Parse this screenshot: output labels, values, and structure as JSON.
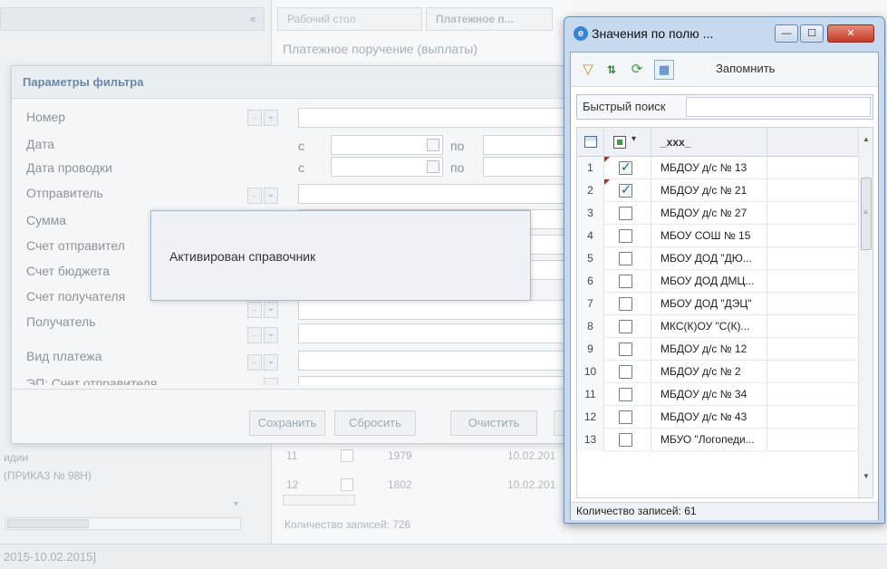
{
  "background": {
    "left_items": [
      "идии",
      "(ПРИКАЗ № 98Н)"
    ],
    "tabs": [
      "Рабочий стол",
      "Платежное п..."
    ],
    "doc_title": "Платежное поручение (выплаты)",
    "grid_rows": [
      {
        "n": "11",
        "num": "1979",
        "date": "10.02.201"
      },
      {
        "n": "12",
        "num": "1802",
        "date": "10.02.201"
      }
    ],
    "count": "Количество записей: 726",
    "status_period": "2015-10.02.2015]"
  },
  "filter": {
    "title": "Параметры фильтра",
    "fields": [
      "Номер",
      "Дата",
      "Дата проводки",
      "Отправитель",
      "Сумма",
      "Счет отправител",
      "Счет бюджета",
      "Счет получателя",
      "Получатель",
      "Вид платежа",
      "ЭП: Счет отправителя"
    ],
    "from_label": "с",
    "to_label": "по",
    "buttons": {
      "save": "Сохранить",
      "reset": "Сбросить",
      "clear": "Очистить"
    }
  },
  "toast": {
    "message": "Активирован справочник"
  },
  "values_window": {
    "title": "Значения по полю ...",
    "toolbar": {
      "remember": "Запомнить"
    },
    "quick_search": {
      "label": "Быстрый поиск",
      "value": ""
    },
    "column_header": "_xxx_",
    "rows": [
      {
        "n": "1",
        "checked": true,
        "name": "МБДОУ д/с № 13"
      },
      {
        "n": "2",
        "checked": true,
        "name": "МБДОУ д/с № 21"
      },
      {
        "n": "3",
        "checked": false,
        "name": "МБДОУ д/с № 27"
      },
      {
        "n": "4",
        "checked": false,
        "name": "МБОУ СОШ № 15"
      },
      {
        "n": "5",
        "checked": false,
        "name": "МБОУ ДОД \"ДЮ..."
      },
      {
        "n": "6",
        "checked": false,
        "name": "МБОУ ДОД ДМЦ..."
      },
      {
        "n": "7",
        "checked": false,
        "name": "МБОУ ДОД \"ДЭЦ\""
      },
      {
        "n": "8",
        "checked": false,
        "name": "МКС(К)ОУ \"С(К)..."
      },
      {
        "n": "9",
        "checked": false,
        "name": "МБДОУ д/с № 12"
      },
      {
        "n": "10",
        "checked": false,
        "name": "МБДОУ д/с № 2"
      },
      {
        "n": "11",
        "checked": false,
        "name": "МБДОУ д/с № 34"
      },
      {
        "n": "12",
        "checked": false,
        "name": "МБДОУ д/с № 43"
      },
      {
        "n": "13",
        "checked": false,
        "name": "МБУО \"Логопеди..."
      }
    ],
    "count": "Количество записей: 61"
  }
}
